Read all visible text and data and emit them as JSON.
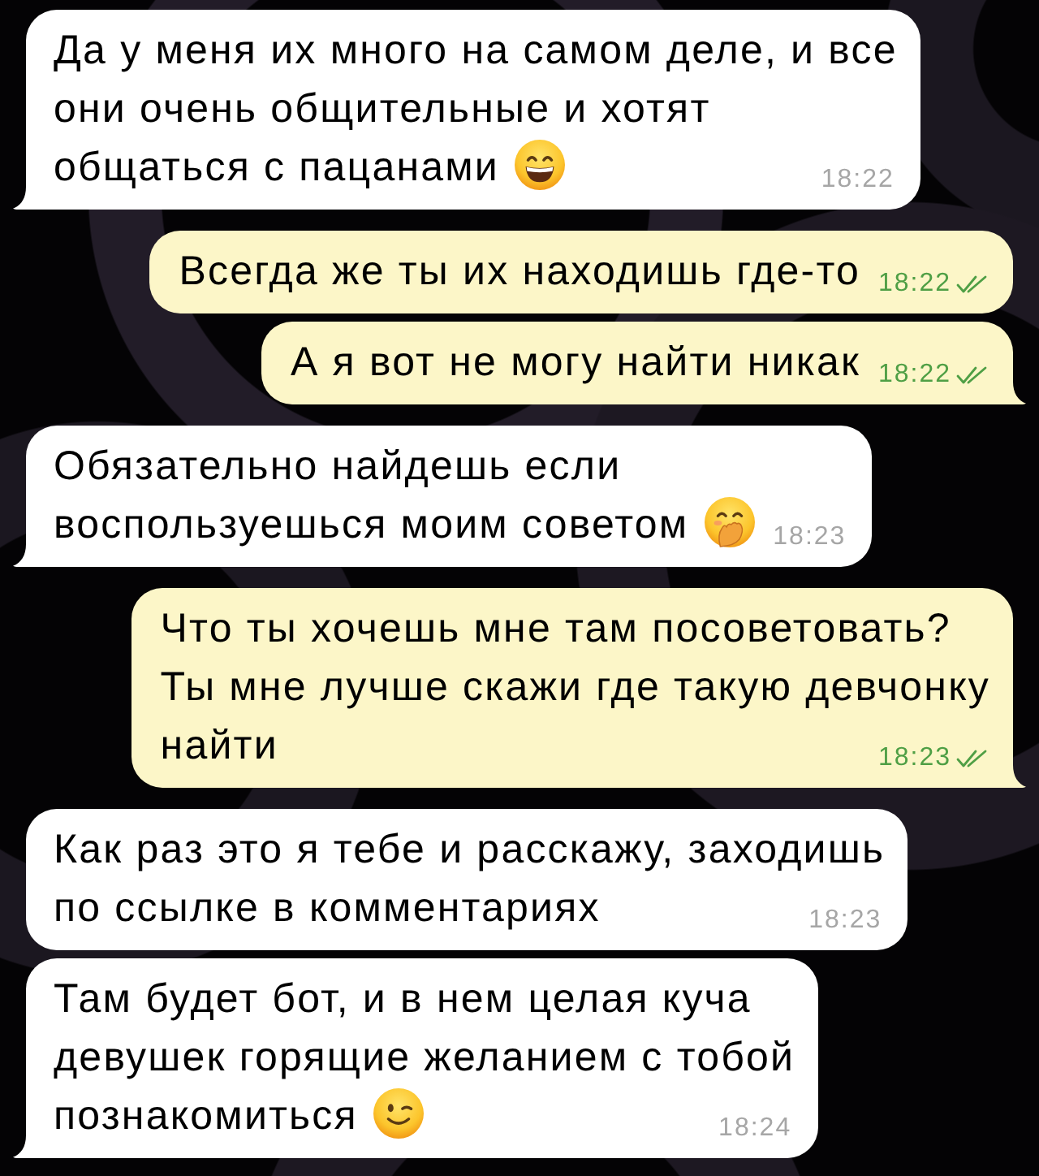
{
  "chat": {
    "messages": [
      {
        "kind": "incoming",
        "lines": [
          "Да у меня их много на самом деле, и все",
          "они очень общительные и хотят",
          "общаться с пацанами"
        ],
        "emoji": {
          "kind": "grinning"
        },
        "time": "18:22",
        "tail": true
      },
      {
        "kind": "outgoing",
        "lines": [
          "Всегда же ты их находишь где-то"
        ],
        "time": "18:22",
        "read": true,
        "tail": false
      },
      {
        "kind": "outgoing",
        "lines": [
          "А я вот не могу найти никак"
        ],
        "time": "18:22",
        "read": true,
        "tail": true
      },
      {
        "kind": "incoming",
        "lines": [
          "Обязательно найдешь если",
          "воспользуешься моим советом"
        ],
        "emoji": {
          "kind": "hand-over-mouth"
        },
        "time": "18:23",
        "tail": true
      },
      {
        "kind": "outgoing",
        "lines": [
          "Что ты хочешь мне там посоветовать?",
          "Ты мне лучше скажи где такую девчонку",
          "найти"
        ],
        "time": "18:23",
        "read": true,
        "tail": true
      },
      {
        "kind": "incoming",
        "lines": [
          "Как раз это я тебе и расскажу, заходишь",
          "по ссылке в комментариях"
        ],
        "time": "18:23",
        "tail": false
      },
      {
        "kind": "incoming",
        "lines": [
          "Там будет бот, и в нем целая куча",
          "девушек горящие желанием с тобой",
          "познакомиться"
        ],
        "emoji": {
          "kind": "wink"
        },
        "time": "18:24",
        "tail": true
      }
    ]
  }
}
